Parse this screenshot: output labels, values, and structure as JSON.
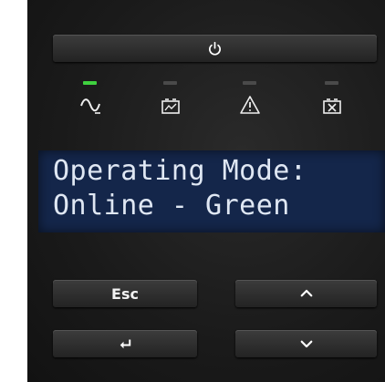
{
  "panel": {
    "power_button": {
      "icon": "power-icon"
    },
    "indicators": [
      {
        "name": "online",
        "icon": "sine-wave-icon",
        "led_color": "#3fd13f",
        "lit": true
      },
      {
        "name": "battery",
        "icon": "battery-mode-icon",
        "led_color": "#4a4a4a",
        "lit": false
      },
      {
        "name": "alarm",
        "icon": "warning-icon",
        "led_color": "#4a4a4a",
        "lit": false
      },
      {
        "name": "replace-battery",
        "icon": "battery-fault-icon",
        "led_color": "#4a4a4a",
        "lit": false
      }
    ],
    "lcd": {
      "line1": "Operating Mode:",
      "line2": "Online - Green",
      "background": "#14264a",
      "text_color": "#dfe7f3"
    },
    "buttons": {
      "esc_label": "Esc",
      "up_icon": "chevron-up-icon",
      "enter_icon": "enter-arrow-icon",
      "down_icon": "chevron-down-icon"
    }
  }
}
